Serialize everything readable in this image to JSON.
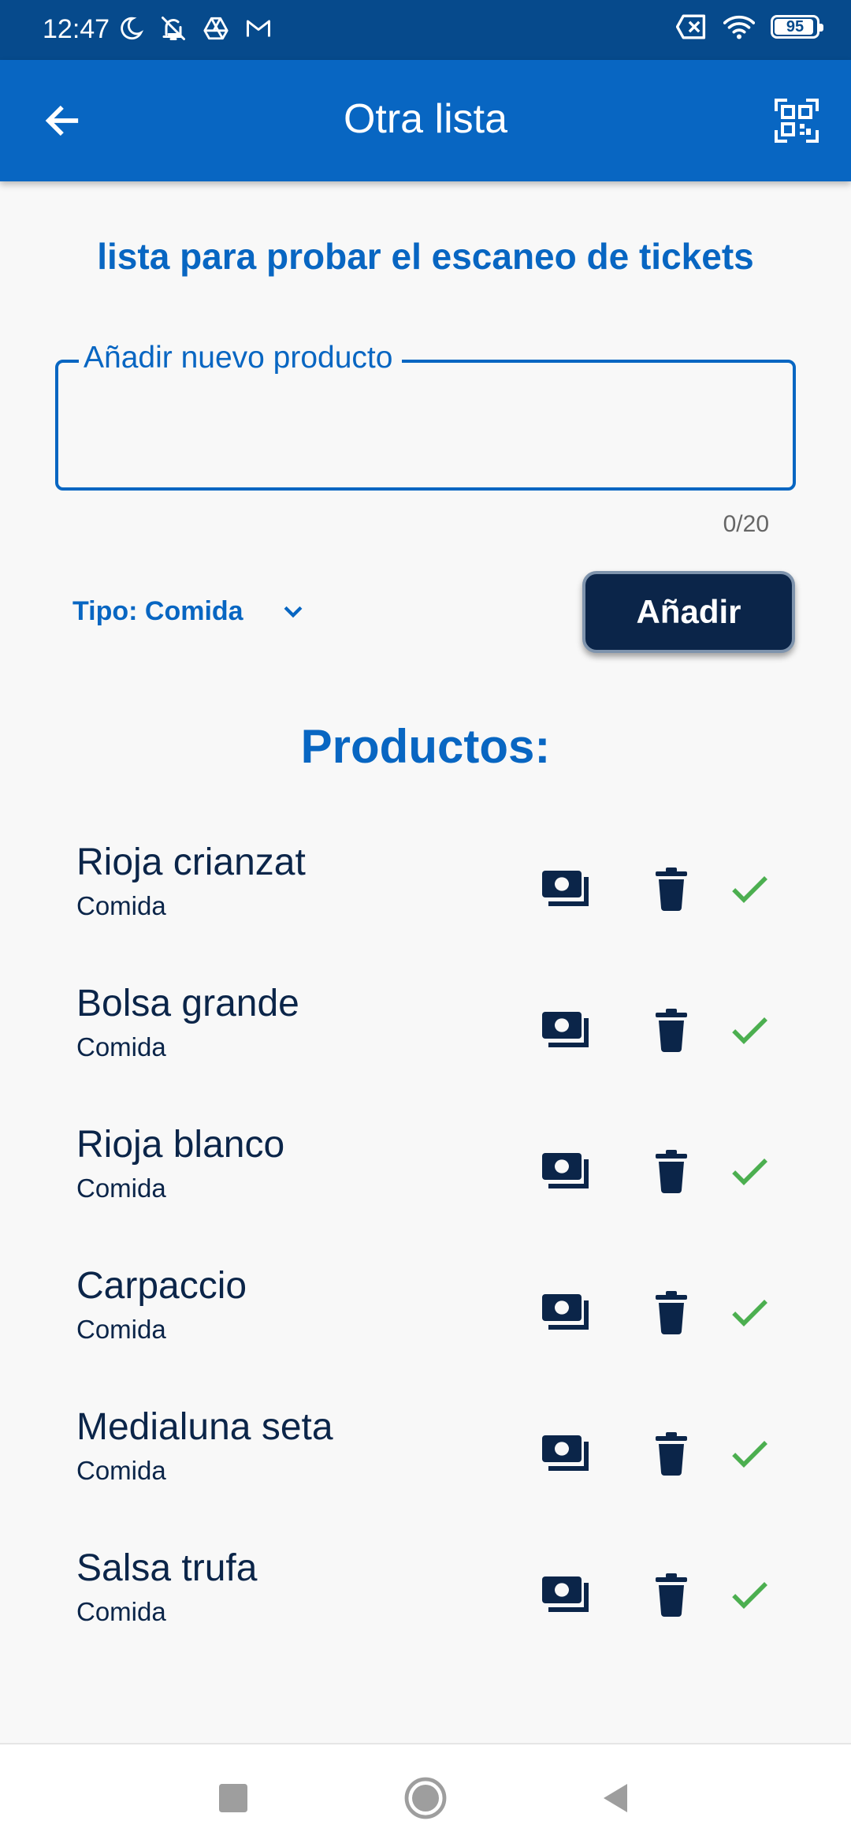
{
  "status_bar": {
    "time": "12:47",
    "battery": "95",
    "battery_level": 0.95,
    "icons_left": [
      "moon-icon",
      "bell-off-icon",
      "drive-icon",
      "gmail-icon"
    ],
    "icons_right": [
      "sim-off-icon",
      "wifi-icon",
      "battery-icon"
    ]
  },
  "app_bar": {
    "title": "Otra lista",
    "back_icon": "arrow-left-icon",
    "qr_icon": "qr-scan-icon"
  },
  "list_description": "lista para probar el escaneo de tickets",
  "new_product": {
    "label": "Añadir nuevo producto",
    "value": "",
    "counter": "0/20"
  },
  "type_select": {
    "selected": "Tipo: Comida",
    "icon": "chevron-down-icon"
  },
  "add_button": "Añadir",
  "products_heading": "Productos:",
  "products": [
    {
      "name": "Rioja crianzat",
      "type": "Comida"
    },
    {
      "name": "Bolsa grande",
      "type": "Comida"
    },
    {
      "name": "Rioja blanco",
      "type": "Comida"
    },
    {
      "name": "Carpaccio",
      "type": "Comida"
    },
    {
      "name": "Medialuna seta",
      "type": "Comida"
    },
    {
      "name": "Salsa trufa",
      "type": "Comida"
    }
  ],
  "row_actions": [
    "cash-icon",
    "trash-icon",
    "check-icon"
  ],
  "colors": {
    "status_bar": "#064a8c",
    "primary": "#0866c2",
    "dark_navy": "#0b2549",
    "check_green": "#4caf50",
    "background": "#f8f8f8"
  },
  "nav_bar": [
    "recents-square-icon",
    "home-circle-icon",
    "back-triangle-icon"
  ]
}
